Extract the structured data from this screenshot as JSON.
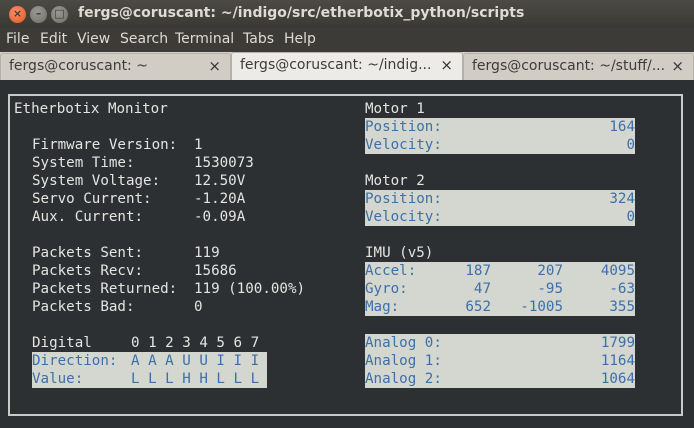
{
  "window": {
    "title": "fergs@coruscant: ~/indigo/src/etherbotix_python/scripts",
    "close_glyph": "×",
    "min_glyph": "–",
    "max_glyph": "□"
  },
  "menu": [
    "File",
    "Edit",
    "View",
    "Search",
    "Terminal",
    "Tabs",
    "Help"
  ],
  "tabs": [
    {
      "label": "fergs@coruscant: ~",
      "active": false
    },
    {
      "label": "fergs@coruscant: ~/indig...",
      "active": true
    },
    {
      "label": "fergs@coruscant: ~/stuff/...",
      "active": false
    }
  ],
  "tab_close_glyph": "×",
  "terminal": {
    "title": "Etherbotix Monitor",
    "firmware": {
      "label": "Firmware Version:",
      "value": "1"
    },
    "system_time": {
      "label": "System Time:",
      "value": "1530073"
    },
    "system_voltage": {
      "label": "System Voltage:",
      "value": "12.50V"
    },
    "servo_current": {
      "label": "Servo Current:",
      "value": "-1.20A"
    },
    "aux_current": {
      "label": "Aux. Current:",
      "value": "-0.09A"
    },
    "packets_sent": {
      "label": "Packets Sent:",
      "value": "119"
    },
    "packets_recv": {
      "label": "Packets Recv:",
      "value": "15686"
    },
    "packets_returned": {
      "label": "Packets Returned:",
      "value": "119 (100.00%)"
    },
    "packets_bad": {
      "label": "Packets Bad:",
      "value": "0"
    },
    "digital": {
      "label": "Digital",
      "pins": "0 1 2 3 4 5 6 7",
      "direction_label": "Direction:",
      "direction": "A A A U U I I I",
      "value_label": "Value:",
      "values": "L L L H H L L L"
    },
    "motor1": {
      "title": "Motor 1",
      "position_label": "Position:",
      "position": "164",
      "velocity_label": "Velocity:",
      "velocity": "0"
    },
    "motor2": {
      "title": "Motor 2",
      "position_label": "Position:",
      "position": "324",
      "velocity_label": "Velocity:",
      "velocity": "0"
    },
    "imu": {
      "title": "IMU (v5)",
      "accel": {
        "label": "Accel:",
        "x": "187",
        "y": "207",
        "z": "4095"
      },
      "gyro": {
        "label": "Gyro:",
        "x": "47",
        "y": "-95",
        "z": "-63"
      },
      "mag": {
        "label": "Mag:",
        "x": "652",
        "y": "-1005",
        "z": "355"
      }
    },
    "analog": [
      {
        "label": "Analog 0:",
        "value": "1799"
      },
      {
        "label": "Analog 1:",
        "value": "1164"
      },
      {
        "label": "Analog 2:",
        "value": "1064"
      }
    ]
  }
}
